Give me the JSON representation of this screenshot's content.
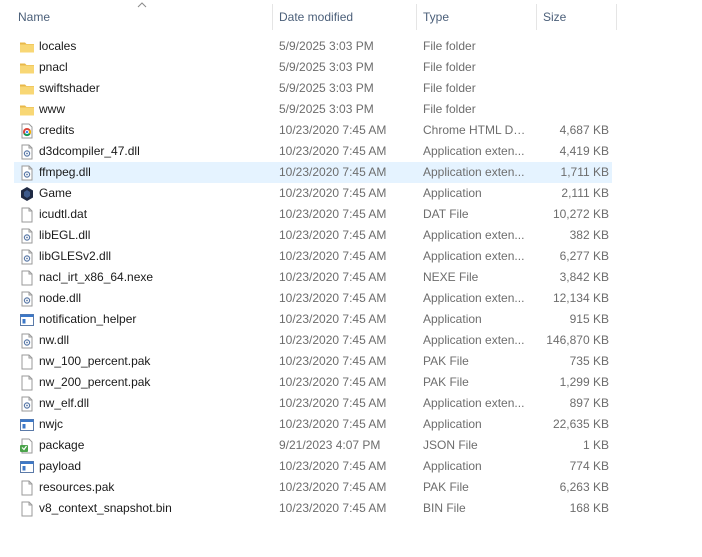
{
  "columns": {
    "name": "Name",
    "date": "Date modified",
    "type": "Type",
    "size": "Size"
  },
  "files": [
    {
      "name": "locales",
      "date": "5/9/2025 3:03 PM",
      "type": "File folder",
      "size": "",
      "icon": "folder-icon"
    },
    {
      "name": "pnacl",
      "date": "5/9/2025 3:03 PM",
      "type": "File folder",
      "size": "",
      "icon": "folder-icon"
    },
    {
      "name": "swiftshader",
      "date": "5/9/2025 3:03 PM",
      "type": "File folder",
      "size": "",
      "icon": "folder-icon"
    },
    {
      "name": "www",
      "date": "5/9/2025 3:03 PM",
      "type": "File folder",
      "size": "",
      "icon": "folder-icon"
    },
    {
      "name": "credits",
      "date": "10/23/2020 7:45 AM",
      "type": "Chrome HTML Do...",
      "size": "4,687 KB",
      "icon": "chrome-html-icon"
    },
    {
      "name": "d3dcompiler_47.dll",
      "date": "10/23/2020 7:45 AM",
      "type": "Application exten...",
      "size": "4,419 KB",
      "icon": "dll-icon"
    },
    {
      "name": "ffmpeg.dll",
      "date": "10/23/2020 7:45 AM",
      "type": "Application exten...",
      "size": "1,711 KB",
      "icon": "dll-icon"
    },
    {
      "name": "Game",
      "date": "10/23/2020 7:45 AM",
      "type": "Application",
      "size": "2,111 KB",
      "icon": "game-app-icon"
    },
    {
      "name": "icudtl.dat",
      "date": "10/23/2020 7:45 AM",
      "type": "DAT File",
      "size": "10,272 KB",
      "icon": "file-icon"
    },
    {
      "name": "libEGL.dll",
      "date": "10/23/2020 7:45 AM",
      "type": "Application exten...",
      "size": "382 KB",
      "icon": "dll-icon"
    },
    {
      "name": "libGLESv2.dll",
      "date": "10/23/2020 7:45 AM",
      "type": "Application exten...",
      "size": "6,277 KB",
      "icon": "dll-icon"
    },
    {
      "name": "nacl_irt_x86_64.nexe",
      "date": "10/23/2020 7:45 AM",
      "type": "NEXE File",
      "size": "3,842 KB",
      "icon": "file-icon"
    },
    {
      "name": "node.dll",
      "date": "10/23/2020 7:45 AM",
      "type": "Application exten...",
      "size": "12,134 KB",
      "icon": "dll-icon"
    },
    {
      "name": "notification_helper",
      "date": "10/23/2020 7:45 AM",
      "type": "Application",
      "size": "915 KB",
      "icon": "application-icon"
    },
    {
      "name": "nw.dll",
      "date": "10/23/2020 7:45 AM",
      "type": "Application exten...",
      "size": "146,870 KB",
      "icon": "dll-icon"
    },
    {
      "name": "nw_100_percent.pak",
      "date": "10/23/2020 7:45 AM",
      "type": "PAK File",
      "size": "735 KB",
      "icon": "file-icon"
    },
    {
      "name": "nw_200_percent.pak",
      "date": "10/23/2020 7:45 AM",
      "type": "PAK File",
      "size": "1,299 KB",
      "icon": "file-icon"
    },
    {
      "name": "nw_elf.dll",
      "date": "10/23/2020 7:45 AM",
      "type": "Application exten...",
      "size": "897 KB",
      "icon": "dll-icon"
    },
    {
      "name": "nwjc",
      "date": "10/23/2020 7:45 AM",
      "type": "Application",
      "size": "22,635 KB",
      "icon": "application-icon"
    },
    {
      "name": "package",
      "date": "9/21/2023 4:07 PM",
      "type": "JSON File",
      "size": "1 KB",
      "icon": "json-file-icon"
    },
    {
      "name": "payload",
      "date": "10/23/2020 7:45 AM",
      "type": "Application",
      "size": "774 KB",
      "icon": "application-icon"
    },
    {
      "name": "resources.pak",
      "date": "10/23/2020 7:45 AM",
      "type": "PAK File",
      "size": "6,263 KB",
      "icon": "file-icon"
    },
    {
      "name": "v8_context_snapshot.bin",
      "date": "10/23/2020 7:45 AM",
      "type": "BIN File",
      "size": "168 KB",
      "icon": "file-icon"
    }
  ],
  "hovered_file": "ffmpeg.dll",
  "sort": {
    "column": "Name",
    "direction": "ascending"
  },
  "colors": {
    "header_text": "#4c607a",
    "hover_row": "#e5f3ff",
    "folder": "#f8d775",
    "secondary_text": "#6d6d6d"
  }
}
